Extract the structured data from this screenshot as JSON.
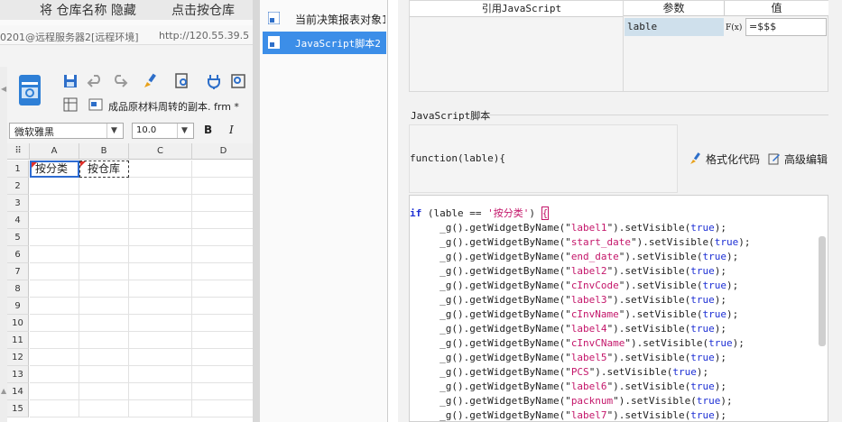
{
  "banner": {
    "text1": "将 仓库名称 隐藏",
    "text2": "点击按仓库"
  },
  "window": {
    "title_left": "0201@远程服务器2[远程环境]",
    "title_right": "http://120.55.39.5"
  },
  "editor_tab": {
    "label": "成品原材料周转的副本. frm *"
  },
  "format_bar": {
    "font_family": "微软雅黑",
    "font_size": "10.0",
    "bold_label": "B",
    "italic_label": "I"
  },
  "grid": {
    "columns": [
      "A",
      "B",
      "C",
      "D"
    ],
    "rows": [
      "1",
      "2",
      "3",
      "4",
      "5",
      "6",
      "7",
      "8",
      "9",
      "10",
      "11",
      "12",
      "13",
      "14",
      "15"
    ],
    "cell_a1": "按分类",
    "cell_b1": "按仓库"
  },
  "mid_list": {
    "items": [
      {
        "label": "当前决策报表对象1"
      },
      {
        "label": "JavaScript脚本2"
      }
    ]
  },
  "right": {
    "ref_js_header": "引用JavaScript",
    "param_header": "参数",
    "value_header": "值",
    "param_name": "lable",
    "param_fx": "F(x)",
    "param_value": "=$$$",
    "js_section_label": "JavaScript脚本",
    "func_signature": "function(lable){",
    "format_code_label": "格式化代码",
    "advanced_edit_label": "高级编辑"
  },
  "code": {
    "if_condition": "'按分类'",
    "lines": [
      {
        "name": "label1"
      },
      {
        "name": "start_date"
      },
      {
        "name": "end_date"
      },
      {
        "name": "label2"
      },
      {
        "name": "cInvCode"
      },
      {
        "name": "label3"
      },
      {
        "name": "cInvName"
      },
      {
        "name": "label4"
      },
      {
        "name": "cInvCName"
      },
      {
        "name": "label5"
      },
      {
        "name": "PCS"
      },
      {
        "name": "label6"
      },
      {
        "name": "packnum"
      },
      {
        "name": "label7"
      }
    ]
  },
  "colors": {
    "selection_blue": "#3c8ee8",
    "keyword_blue": "#1d2fd4",
    "string_magenta": "#c4166a"
  }
}
